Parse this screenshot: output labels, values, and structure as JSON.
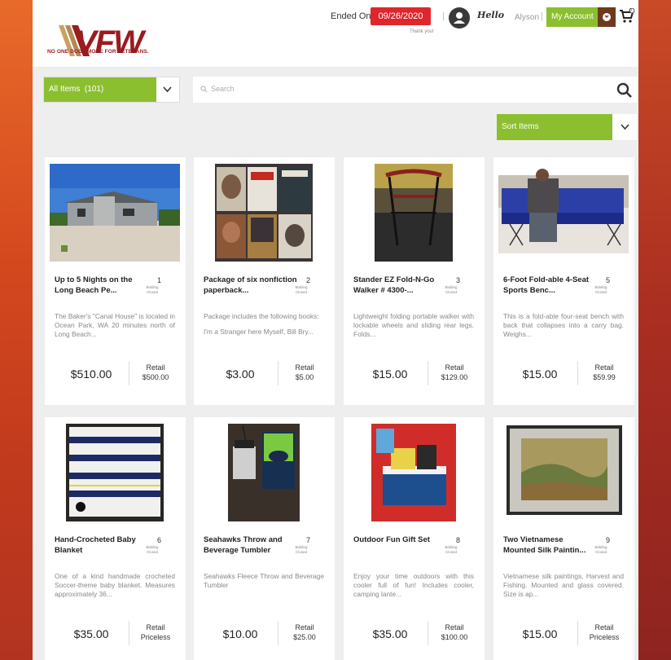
{
  "header": {
    "logo_text": "VFW",
    "logo_tagline": "NO ONE DOES MORE FOR VETERANS.",
    "ended_label": "Ended On",
    "ended_date": "09/26/2020",
    "thanks": "Thank you!",
    "hello": "Hello",
    "username": "Alyson",
    "account_label": "My Account",
    "cart_count": "0"
  },
  "filters": {
    "category_label": "All Items",
    "category_count": "(101)",
    "search_placeholder": "Search",
    "sort_label": "Sort Items"
  },
  "items": [
    {
      "title": "Up to 5 Nights on the Long Beach Pe...",
      "num": "1",
      "status": "Bidding Closed",
      "desc": [
        "The Baker's \"Canal House\" is located in Ocean Park, WA 20 minutes north of Long Beach..."
      ],
      "price": "$510.00",
      "retail_label": "Retail",
      "retail": "$500.00",
      "image": "house-photo"
    },
    {
      "title": "Package of six nonfiction paperback...",
      "num": "2",
      "status": "Bidding Closed",
      "desc": [
        "Package includes the following books:",
        "I'm a Stranger here Myself, Bill Bry..."
      ],
      "price": "$3.00",
      "retail_label": "Retail",
      "retail": "$5.00",
      "image": "books-photo"
    },
    {
      "title": "Stander EZ Fold-N-Go Walker # 4300-...",
      "num": "3",
      "status": "Bidding Closed",
      "desc": [
        "Lightweight folding portable walker with lockable wheels and sliding rear legs. Folds..."
      ],
      "price": "$15.00",
      "retail_label": "Retail",
      "retail": "$129.00",
      "image": "walker-photo"
    },
    {
      "title": "6-Foot Fold-able 4-Seat Sports Benc...",
      "num": "5",
      "status": "Bidding Closed",
      "desc": [
        "This is a fold-able four-seat bench with back that collapses into a carry bag. Weighs..."
      ],
      "price": "$15.00",
      "retail_label": "Retail",
      "retail": "$59.99",
      "image": "bench-photo"
    },
    {
      "title": "Hand-Crocheted Baby Blanket",
      "num": "6",
      "status": "Bidding Closed",
      "desc": [
        "One of a kind handmade crocheted Soccer-theme baby blanket. Measures approximately 36..."
      ],
      "price": "$35.00",
      "retail_label": "Retail",
      "retail": "Priceless",
      "image": "blanket-photo"
    },
    {
      "title": "Seahawks Throw and Beverage Tumbler",
      "num": "7",
      "status": "Bidding Closed",
      "desc": [
        "Seahawks Fleece Throw and Beverage Tumbler"
      ],
      "price": "$10.00",
      "retail_label": "Retail",
      "retail": "$25.00",
      "image": "tumbler-photo"
    },
    {
      "title": "Outdoor Fun Gift Set",
      "num": "8",
      "status": "Bidding Closed",
      "desc": [
        "Enjoy your time outdoors with this cooler full of fun! Includes cooler, camping lante..."
      ],
      "price": "$35.00",
      "retail_label": "Retail",
      "retail": "$100.00",
      "image": "cooler-photo"
    },
    {
      "title": "Two Vietnamese Mounted Silk Paintin...",
      "num": "9",
      "status": "Bidding Closed",
      "desc": [
        "Vietnamese silk paintings, Harvest and Fishing. Mounted and glass covered. Size is ap..."
      ],
      "price": "$15.00",
      "retail_label": "Retail",
      "retail": "Priceless",
      "image": "painting-photo"
    }
  ],
  "colors": {
    "accent": "#8cbf30",
    "brand": "#9b1b1f",
    "ended": "#e0262c"
  }
}
